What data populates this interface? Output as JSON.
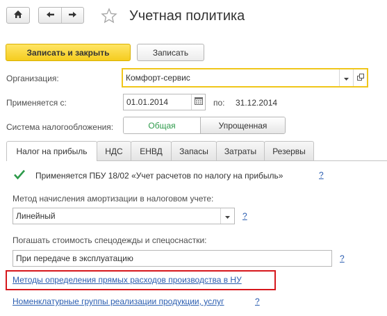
{
  "window": {
    "title": "Учетная политика"
  },
  "toolbar": {
    "save_close_label": "Записать и закрыть",
    "save_label": "Записать"
  },
  "form": {
    "organization_label": "Организация:",
    "organization_value": "Комфорт-сервис",
    "applies_from_label": "Применяется с:",
    "applies_from_value": "01.01.2014",
    "to_label": "по:",
    "to_value": "31.12.2014",
    "tax_system_label": "Система налогообложения:",
    "tax_system_options": [
      "Общая",
      "Упрощенная"
    ],
    "tax_system_selected": "Общая"
  },
  "tabs": [
    {
      "label": "Налог на прибыль",
      "active": true
    },
    {
      "label": "НДС",
      "active": false
    },
    {
      "label": "ЕНВД",
      "active": false
    },
    {
      "label": "Запасы",
      "active": false
    },
    {
      "label": "Затраты",
      "active": false
    },
    {
      "label": "Резервы",
      "active": false
    }
  ],
  "profit_tax": {
    "pbu_checkbox_label": "Применяется ПБУ 18/02 «Учет расчетов по налогу на прибыль»",
    "pbu_checked": true,
    "depreciation_label": "Метод начисления амортизации в налоговом учете:",
    "depreciation_value": "Линейный",
    "workwear_label": "Погашать стоимость спецодежды и спецоснастки:",
    "workwear_value": "При передаче в эксплуатацию",
    "direct_costs_link": "Методы определения прямых расходов производства в НУ",
    "nomenclature_link": "Номенклатурные группы реализации продукции, услуг",
    "help_label": "?"
  },
  "colors": {
    "accent_yellow": "#f5cc1e",
    "active_option_green": "#2d9a4a",
    "link_blue": "#2a5db0",
    "highlight_red": "#d6171c"
  }
}
